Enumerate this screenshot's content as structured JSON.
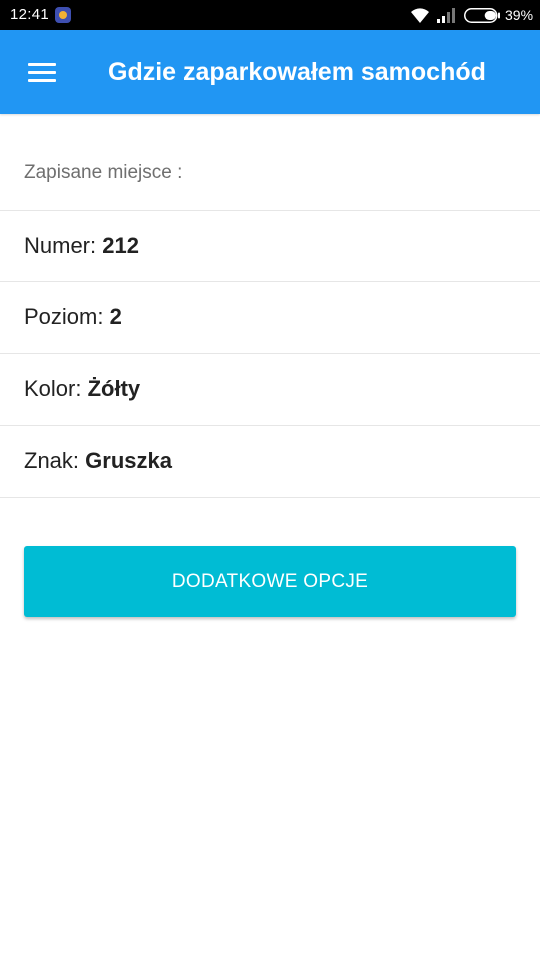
{
  "status_bar": {
    "time": "12:41",
    "battery_percent": "39%",
    "battery_level": 0.39,
    "icons": [
      "app-notification-icon",
      "wifi-icon",
      "signal-icon",
      "battery-icon"
    ]
  },
  "app_bar": {
    "title": "Gdzie zaparkowałem samochód",
    "menu_icon": "hamburger-menu-icon",
    "color": "#2196f3"
  },
  "saved_place": {
    "header": "Zapisane miejsce :",
    "rows": [
      {
        "label": "Numer: ",
        "value": "212"
      },
      {
        "label": "Poziom: ",
        "value": "2"
      },
      {
        "label": "Kolor: ",
        "value": "Żółty"
      },
      {
        "label": "Znak: ",
        "value": "Gruszka"
      }
    ]
  },
  "actions": {
    "more_options_label": "DODATKOWE OPCJE",
    "button_color": "#00bcd4"
  }
}
